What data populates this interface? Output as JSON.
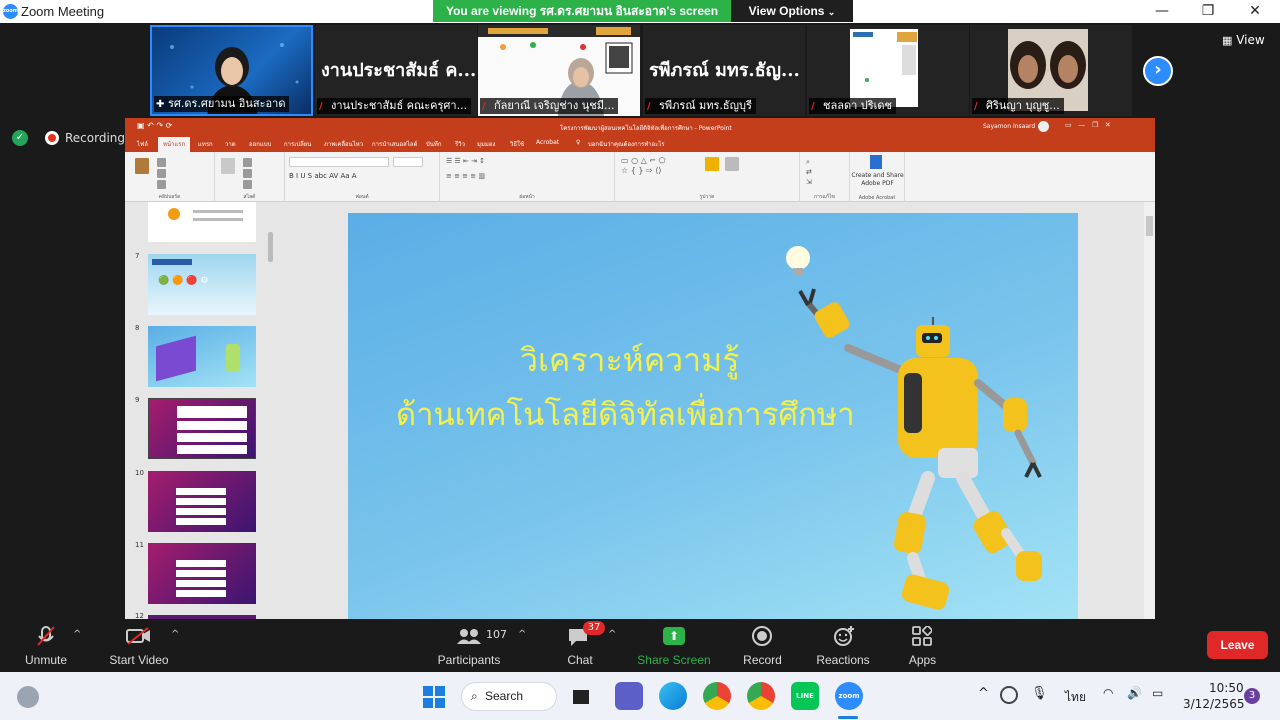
{
  "window": {
    "title": "Zoom Meeting"
  },
  "share_banner": {
    "text": "You are viewing รศ.ดร.ศยามน อินสะอาด's screen",
    "view_options": "View Options"
  },
  "thumbnails": [
    {
      "name": "รศ.ดร.ศยามน อินสะอาด",
      "big_name": ""
    },
    {
      "name": "งานประชาสัมธ์ คณะครุศา...",
      "big_name": "งานประชาสัมธ์ ค..."
    },
    {
      "name": "กัลยาณี เจริญช่าง นุชมี...",
      "big_name": ""
    },
    {
      "name": "รพีภรณ์ มทร.ธัญบุรี",
      "big_name": "รพีภรณ์ มทร.ธัญ..."
    },
    {
      "name": "ชลลดา ปริเดช",
      "big_name": ""
    },
    {
      "name": "ศิรินญา บุญชู...",
      "big_name": ""
    }
  ],
  "view_button": "View",
  "recording": {
    "label": "Recording"
  },
  "powerpoint": {
    "window_title": "โครงการพัฒนาผู้สอนเทคโนโลยีดิจิทัลเพื่อการศึกษา - PowerPoint",
    "user": "Sayamon Insaard",
    "tabs": [
      "ไฟล์",
      "หน้าแรก",
      "แทรก",
      "วาด",
      "ออกแบบ",
      "การเปลี่ยน",
      "ภาพเคลื่อนไหว",
      "การนำเสนอสไลด์",
      "บันทึก",
      "รีวิว",
      "มุมมอง",
      "วิธีใช้",
      "Acrobat",
      "บอกฉันว่าคุณต้องการทำอะไร"
    ],
    "ribbon_groups": [
      "คลิปบอร์ด",
      "สไลด์",
      "ฟอนต์",
      "ย่อหน้า",
      "รูปวาด",
      "การแก้ไข",
      "Adobe Acrobat"
    ],
    "acrobat_button": "Create and Share Adobe PDF",
    "slide_numbers": [
      "7",
      "8",
      "9",
      "10",
      "11",
      "12"
    ],
    "slide_text": {
      "line1": "วิเคราะห์ความรู้",
      "line2": "ด้านเทคโนโลยีดิจิทัลเพื่อการศึกษา"
    }
  },
  "toolbar": {
    "unmute": "Unmute",
    "start_video": "Start Video",
    "participants": "Participants",
    "participants_count": "107",
    "chat": "Chat",
    "chat_badge": "37",
    "share_screen": "Share Screen",
    "record": "Record",
    "reactions": "Reactions",
    "apps": "Apps",
    "leave": "Leave"
  },
  "taskbar": {
    "search": "Search",
    "language": "ไทย",
    "time": "10:50",
    "date": "3/12/2565",
    "notifications": "3"
  },
  "colors": {
    "zoom_blue": "#2d8cff",
    "share_green": "#2db24a",
    "leave_red": "#e02828",
    "ppt_orange": "#c43e1c",
    "slide_text": "#f4f04d"
  }
}
